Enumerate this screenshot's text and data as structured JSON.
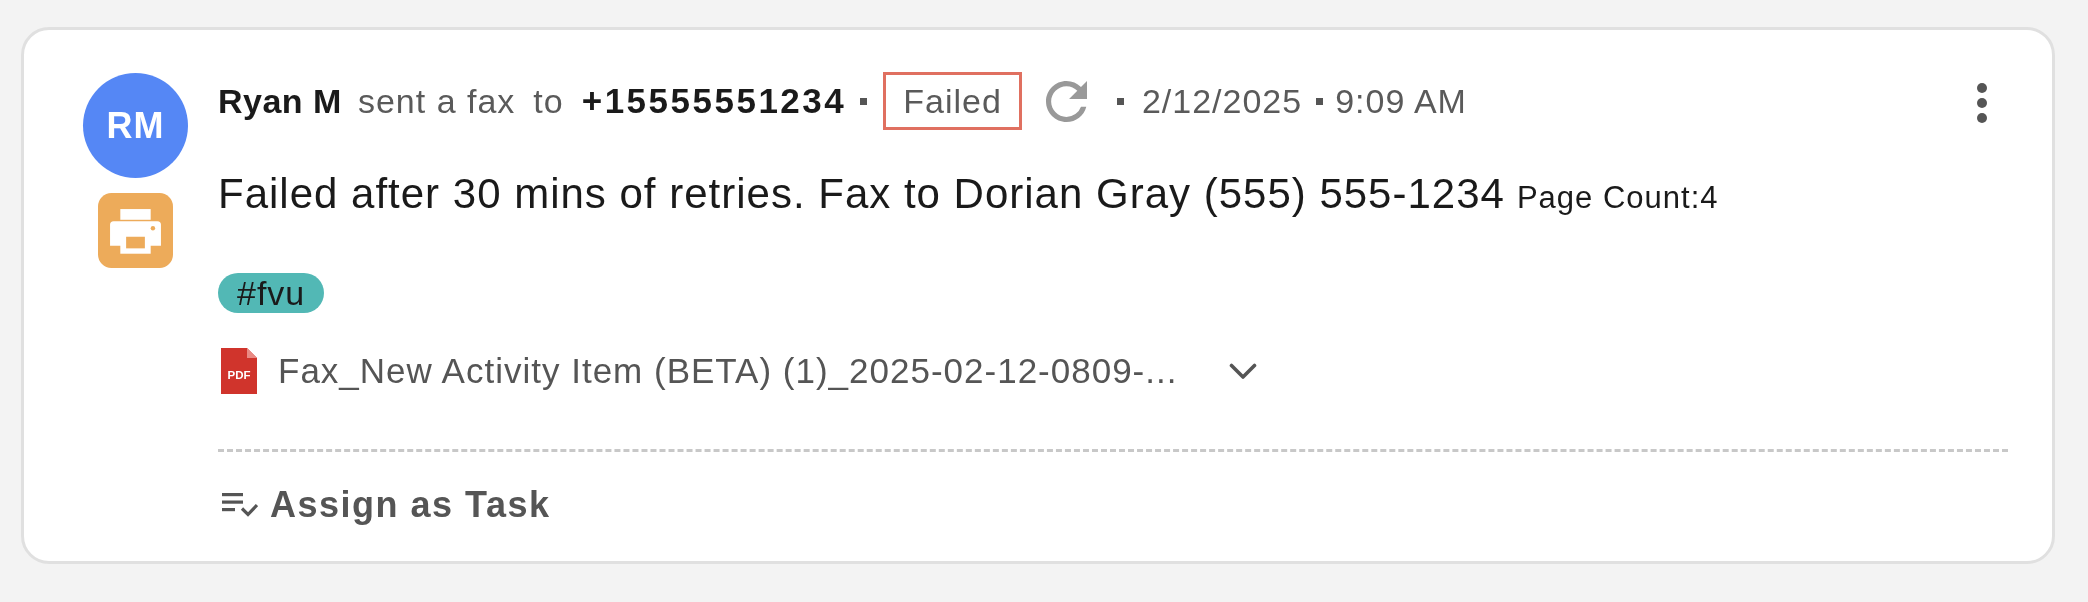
{
  "sender": {
    "initials": "RM",
    "name": "Ryan M"
  },
  "event": {
    "action": "sent a fax",
    "preposition": "to",
    "recipient": "+15555551234",
    "status": "Failed",
    "date": "2/12/2025",
    "time": "9:09 AM"
  },
  "message": {
    "text": "Failed after 30 mins of retries. Fax to Dorian Gray (555) 555-1234",
    "page_count": "Page Count:4"
  },
  "tags": [
    {
      "label": "#fvu",
      "color": "#52b8b5"
    }
  ],
  "attachments": [
    {
      "kind": "pdf",
      "badge": "PDF",
      "file_name": "Fax_New Activity Item (BETA) (1)_2025-02-12-0809-...",
      "expanded": false
    }
  ],
  "actions": [
    {
      "label": "Assign as Task"
    }
  ]
}
